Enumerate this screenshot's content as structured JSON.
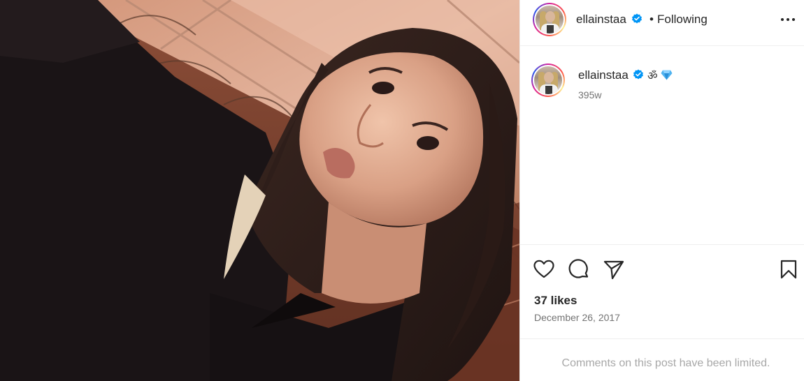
{
  "post": {
    "username": "ellainstaa",
    "verified": true,
    "follow_status": "Following",
    "separator": "•",
    "more_icon": "more-horizontal-icon"
  },
  "caption": {
    "username": "ellainstaa",
    "emoji_text": "ॐ",
    "emoji_gem": "gem-emoji",
    "time_ago": "395w"
  },
  "actions": {
    "like_icon": "heart-icon",
    "comment_icon": "comment-icon",
    "share_icon": "send-icon",
    "save_icon": "bookmark-icon"
  },
  "stats": {
    "likes": "37 likes",
    "date": "December 26, 2017"
  },
  "footer": {
    "comments_limited": "Comments on this post have been limited."
  },
  "colors": {
    "verified_blue": "#0095f6",
    "text_primary": "#262626",
    "text_secondary": "#737373",
    "text_muted": "#a8a8a8",
    "border": "#efefef"
  }
}
